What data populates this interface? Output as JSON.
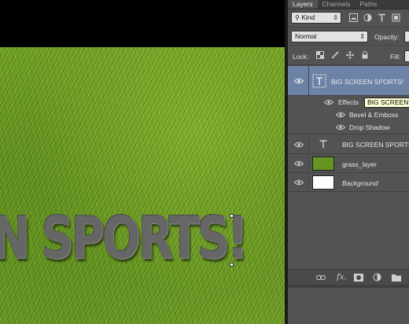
{
  "canvas": {
    "text": "N SPORTS!",
    "text_color": "#666666"
  },
  "tabs": [
    {
      "label": "Layers",
      "active": true
    },
    {
      "label": "Channels",
      "active": false
    },
    {
      "label": "Paths",
      "active": false
    }
  ],
  "filter": {
    "kind_label": "Kind",
    "icons": [
      "image-filter-icon",
      "adjustment-filter-icon",
      "type-filter-icon",
      "shape-filter-icon"
    ]
  },
  "blend": {
    "mode": "Normal",
    "opacity_label": "Opacity:"
  },
  "lock": {
    "label": "Lock:",
    "fill_label": "Fill:"
  },
  "layers": [
    {
      "name": "BIG SCREEN SPORTS!",
      "type": "text-smart",
      "selected": true,
      "visible": true
    },
    {
      "name": "Effects",
      "type": "effects-group"
    },
    {
      "name": "Bevel & Emboss",
      "type": "effect"
    },
    {
      "name": "Drop Shadow",
      "type": "effect"
    },
    {
      "name": "BIG SCREEN SPORTS!",
      "type": "text",
      "visible": true
    },
    {
      "name": "grass_layer",
      "type": "pixel",
      "visible": true
    },
    {
      "name": "Background",
      "type": "background",
      "visible": true
    }
  ],
  "tooltip": "BIG SCREEN SPORTS!",
  "bottom_icons": [
    "link-icon",
    "fx-icon",
    "mask-icon",
    "adjustment-icon",
    "folder-icon"
  ],
  "bottom_labels": {
    "fx": "fx."
  },
  "colors": {
    "panel_bg": "#535353",
    "selected_row": "#6c83a6",
    "tooltip_bg": "#ffffd9"
  }
}
